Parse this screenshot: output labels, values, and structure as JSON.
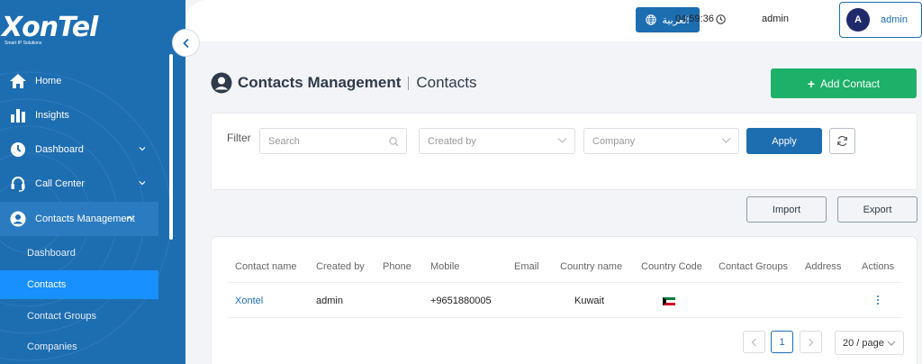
{
  "logo": {
    "text": "XonTel",
    "tagline": "Smart IP Solutions"
  },
  "sidebar": {
    "items": [
      {
        "label": "Home",
        "icon": "home-icon",
        "has_chevron": false
      },
      {
        "label": "Insights",
        "icon": "bar-chart-icon",
        "has_chevron": false
      },
      {
        "label": "Dashboard",
        "icon": "clock-icon",
        "has_chevron": true
      },
      {
        "label": "Call Center",
        "icon": "headset-icon",
        "has_chevron": true
      },
      {
        "label": "Contacts Management",
        "icon": "user-circle-icon",
        "has_chevron": true,
        "expanded": true
      }
    ],
    "sub_items": [
      {
        "label": "Dashboard",
        "selected": false
      },
      {
        "label": "Contacts",
        "selected": true
      },
      {
        "label": "Contact Groups",
        "selected": false
      },
      {
        "label": "Companies",
        "selected": false
      }
    ]
  },
  "topbar": {
    "language_button": "العربية",
    "time": "04:59:36",
    "username": "admin",
    "user_menu": {
      "avatar_letter": "A",
      "name": "admin"
    }
  },
  "page": {
    "title": "Contacts Management",
    "subtitle": "Contacts",
    "add_button": "Add Contact"
  },
  "filter": {
    "label": "Filter",
    "search_placeholder": "Search",
    "created_by_placeholder": "Created by",
    "company_placeholder": "Company",
    "apply_button": "Apply"
  },
  "actions": {
    "import_button": "Import",
    "export_button": "Export"
  },
  "table": {
    "columns": [
      "Contact name",
      "Created by",
      "Phone",
      "Mobile",
      "Email",
      "Country name",
      "Country Code",
      "Contact Groups",
      "Address",
      "Actions"
    ],
    "rows": [
      {
        "contact_name": "Xontel",
        "created_by": "admin",
        "phone": "",
        "mobile": "+9651880005",
        "email": "",
        "country_name": "Kuwait",
        "country_code_flag": "kuwait-flag-icon",
        "contact_groups": "",
        "address": ""
      }
    ]
  },
  "pagination": {
    "current_page": "1",
    "page_size": "20 / page"
  },
  "colors": {
    "sidebar": "#1d6db1",
    "selected_nav": "#1890ff",
    "primary": "#1d6db1",
    "success": "#1cb068",
    "background": "#f3f4f7"
  }
}
